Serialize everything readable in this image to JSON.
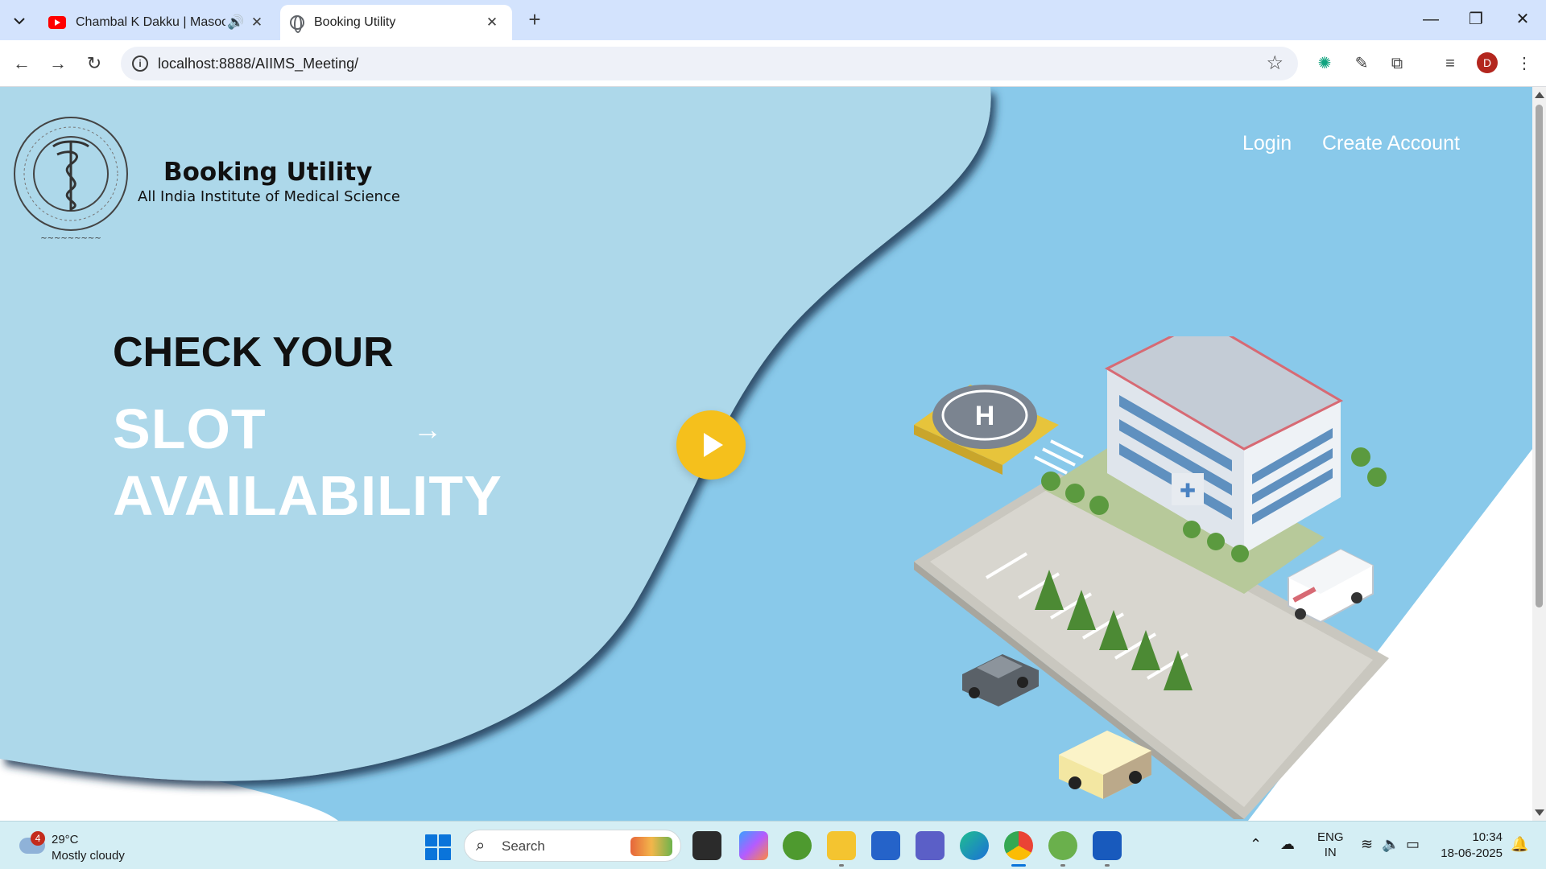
{
  "browser": {
    "tabs": [
      {
        "title": "Chambal K Dakku | Masoom",
        "icon": "youtube-icon",
        "audio": true,
        "active": false
      },
      {
        "title": "Booking Utility",
        "icon": "globe-icon",
        "active": true
      }
    ],
    "url": "localhost:8888/AIIMS_Meeting/",
    "profile_initial": "D"
  },
  "site": {
    "title": "Booking Utility",
    "subtitle": "All India Institute of Medical Science",
    "nav": {
      "login": "Login",
      "create_account": "Create Account"
    },
    "hero": {
      "line1": "CHECK YOUR",
      "line2": "SLOT",
      "line3": "AVAILABILITY",
      "arrow": "→"
    }
  },
  "colors": {
    "accent_yellow": "#f5c01c",
    "sky_light": "#add8ea",
    "sky_mid": "#89c9ea",
    "wave_shadow": "#1f3a55"
  },
  "taskbar": {
    "weather": {
      "badge": "4",
      "temp": "29°C",
      "condition": "Mostly cloudy"
    },
    "search_placeholder": "Search",
    "language": {
      "line1": "ENG",
      "line2": "IN"
    },
    "clock": {
      "time": "10:34",
      "date": "18-06-2025"
    }
  }
}
